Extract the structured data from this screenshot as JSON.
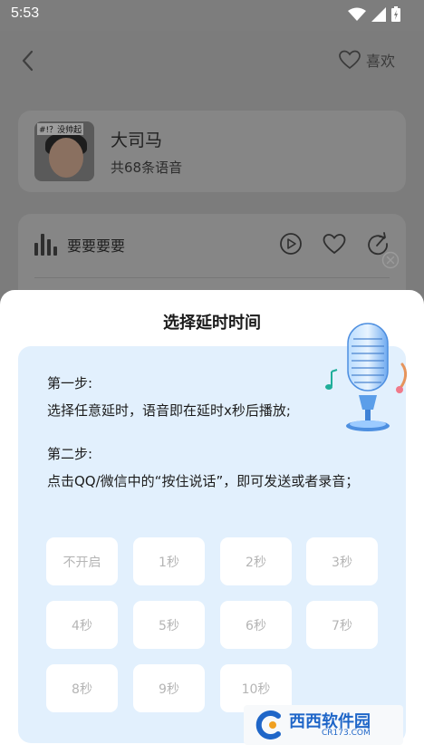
{
  "status_bar": {
    "time": "5:53"
  },
  "header": {
    "like_label": "喜欢"
  },
  "user": {
    "name": "大司马",
    "count": "共68条语音",
    "avatar_caption": "#!？没帅起"
  },
  "voice": {
    "title": "要要要要"
  },
  "sheet": {
    "title": "选择延时时间",
    "step1_label": "第一步:",
    "step1_text": "选择任意延时，语音即在延时x秒后播放;",
    "step2_label": "第二步:",
    "step2_text": "点击QQ/微信中的“按住说话”，即可发送或者录音；",
    "options": [
      "不开启",
      "1秒",
      "2秒",
      "3秒",
      "4秒",
      "5秒",
      "6秒",
      "7秒",
      "8秒",
      "9秒",
      "10秒"
    ]
  },
  "watermark": {
    "brand": "西西软件园",
    "site": "CR173.COM"
  },
  "colors": {
    "panel": "#e2f0fd",
    "accent": "#1f66c8"
  }
}
